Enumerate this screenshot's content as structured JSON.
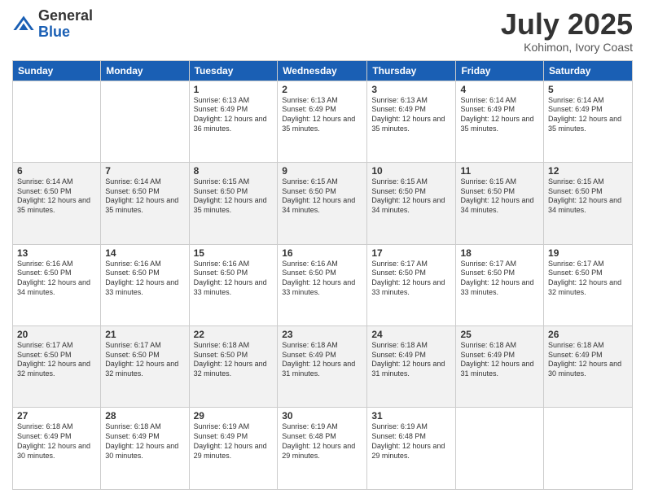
{
  "logo": {
    "general": "General",
    "blue": "Blue"
  },
  "title": "July 2025",
  "subtitle": "Kohimon, Ivory Coast",
  "days": [
    "Sunday",
    "Monday",
    "Tuesday",
    "Wednesday",
    "Thursday",
    "Friday",
    "Saturday"
  ],
  "weeks": [
    [
      {
        "day": "",
        "sunrise": "",
        "sunset": "",
        "daylight": ""
      },
      {
        "day": "",
        "sunrise": "",
        "sunset": "",
        "daylight": ""
      },
      {
        "day": "1",
        "sunrise": "Sunrise: 6:13 AM",
        "sunset": "Sunset: 6:49 PM",
        "daylight": "Daylight: 12 hours and 36 minutes."
      },
      {
        "day": "2",
        "sunrise": "Sunrise: 6:13 AM",
        "sunset": "Sunset: 6:49 PM",
        "daylight": "Daylight: 12 hours and 35 minutes."
      },
      {
        "day": "3",
        "sunrise": "Sunrise: 6:13 AM",
        "sunset": "Sunset: 6:49 PM",
        "daylight": "Daylight: 12 hours and 35 minutes."
      },
      {
        "day": "4",
        "sunrise": "Sunrise: 6:14 AM",
        "sunset": "Sunset: 6:49 PM",
        "daylight": "Daylight: 12 hours and 35 minutes."
      },
      {
        "day": "5",
        "sunrise": "Sunrise: 6:14 AM",
        "sunset": "Sunset: 6:49 PM",
        "daylight": "Daylight: 12 hours and 35 minutes."
      }
    ],
    [
      {
        "day": "6",
        "sunrise": "Sunrise: 6:14 AM",
        "sunset": "Sunset: 6:50 PM",
        "daylight": "Daylight: 12 hours and 35 minutes."
      },
      {
        "day": "7",
        "sunrise": "Sunrise: 6:14 AM",
        "sunset": "Sunset: 6:50 PM",
        "daylight": "Daylight: 12 hours and 35 minutes."
      },
      {
        "day": "8",
        "sunrise": "Sunrise: 6:15 AM",
        "sunset": "Sunset: 6:50 PM",
        "daylight": "Daylight: 12 hours and 35 minutes."
      },
      {
        "day": "9",
        "sunrise": "Sunrise: 6:15 AM",
        "sunset": "Sunset: 6:50 PM",
        "daylight": "Daylight: 12 hours and 34 minutes."
      },
      {
        "day": "10",
        "sunrise": "Sunrise: 6:15 AM",
        "sunset": "Sunset: 6:50 PM",
        "daylight": "Daylight: 12 hours and 34 minutes."
      },
      {
        "day": "11",
        "sunrise": "Sunrise: 6:15 AM",
        "sunset": "Sunset: 6:50 PM",
        "daylight": "Daylight: 12 hours and 34 minutes."
      },
      {
        "day": "12",
        "sunrise": "Sunrise: 6:15 AM",
        "sunset": "Sunset: 6:50 PM",
        "daylight": "Daylight: 12 hours and 34 minutes."
      }
    ],
    [
      {
        "day": "13",
        "sunrise": "Sunrise: 6:16 AM",
        "sunset": "Sunset: 6:50 PM",
        "daylight": "Daylight: 12 hours and 34 minutes."
      },
      {
        "day": "14",
        "sunrise": "Sunrise: 6:16 AM",
        "sunset": "Sunset: 6:50 PM",
        "daylight": "Daylight: 12 hours and 33 minutes."
      },
      {
        "day": "15",
        "sunrise": "Sunrise: 6:16 AM",
        "sunset": "Sunset: 6:50 PM",
        "daylight": "Daylight: 12 hours and 33 minutes."
      },
      {
        "day": "16",
        "sunrise": "Sunrise: 6:16 AM",
        "sunset": "Sunset: 6:50 PM",
        "daylight": "Daylight: 12 hours and 33 minutes."
      },
      {
        "day": "17",
        "sunrise": "Sunrise: 6:17 AM",
        "sunset": "Sunset: 6:50 PM",
        "daylight": "Daylight: 12 hours and 33 minutes."
      },
      {
        "day": "18",
        "sunrise": "Sunrise: 6:17 AM",
        "sunset": "Sunset: 6:50 PM",
        "daylight": "Daylight: 12 hours and 33 minutes."
      },
      {
        "day": "19",
        "sunrise": "Sunrise: 6:17 AM",
        "sunset": "Sunset: 6:50 PM",
        "daylight": "Daylight: 12 hours and 32 minutes."
      }
    ],
    [
      {
        "day": "20",
        "sunrise": "Sunrise: 6:17 AM",
        "sunset": "Sunset: 6:50 PM",
        "daylight": "Daylight: 12 hours and 32 minutes."
      },
      {
        "day": "21",
        "sunrise": "Sunrise: 6:17 AM",
        "sunset": "Sunset: 6:50 PM",
        "daylight": "Daylight: 12 hours and 32 minutes."
      },
      {
        "day": "22",
        "sunrise": "Sunrise: 6:18 AM",
        "sunset": "Sunset: 6:50 PM",
        "daylight": "Daylight: 12 hours and 32 minutes."
      },
      {
        "day": "23",
        "sunrise": "Sunrise: 6:18 AM",
        "sunset": "Sunset: 6:49 PM",
        "daylight": "Daylight: 12 hours and 31 minutes."
      },
      {
        "day": "24",
        "sunrise": "Sunrise: 6:18 AM",
        "sunset": "Sunset: 6:49 PM",
        "daylight": "Daylight: 12 hours and 31 minutes."
      },
      {
        "day": "25",
        "sunrise": "Sunrise: 6:18 AM",
        "sunset": "Sunset: 6:49 PM",
        "daylight": "Daylight: 12 hours and 31 minutes."
      },
      {
        "day": "26",
        "sunrise": "Sunrise: 6:18 AM",
        "sunset": "Sunset: 6:49 PM",
        "daylight": "Daylight: 12 hours and 30 minutes."
      }
    ],
    [
      {
        "day": "27",
        "sunrise": "Sunrise: 6:18 AM",
        "sunset": "Sunset: 6:49 PM",
        "daylight": "Daylight: 12 hours and 30 minutes."
      },
      {
        "day": "28",
        "sunrise": "Sunrise: 6:18 AM",
        "sunset": "Sunset: 6:49 PM",
        "daylight": "Daylight: 12 hours and 30 minutes."
      },
      {
        "day": "29",
        "sunrise": "Sunrise: 6:19 AM",
        "sunset": "Sunset: 6:49 PM",
        "daylight": "Daylight: 12 hours and 29 minutes."
      },
      {
        "day": "30",
        "sunrise": "Sunrise: 6:19 AM",
        "sunset": "Sunset: 6:48 PM",
        "daylight": "Daylight: 12 hours and 29 minutes."
      },
      {
        "day": "31",
        "sunrise": "Sunrise: 6:19 AM",
        "sunset": "Sunset: 6:48 PM",
        "daylight": "Daylight: 12 hours and 29 minutes."
      },
      {
        "day": "",
        "sunrise": "",
        "sunset": "",
        "daylight": ""
      },
      {
        "day": "",
        "sunrise": "",
        "sunset": "",
        "daylight": ""
      }
    ]
  ]
}
